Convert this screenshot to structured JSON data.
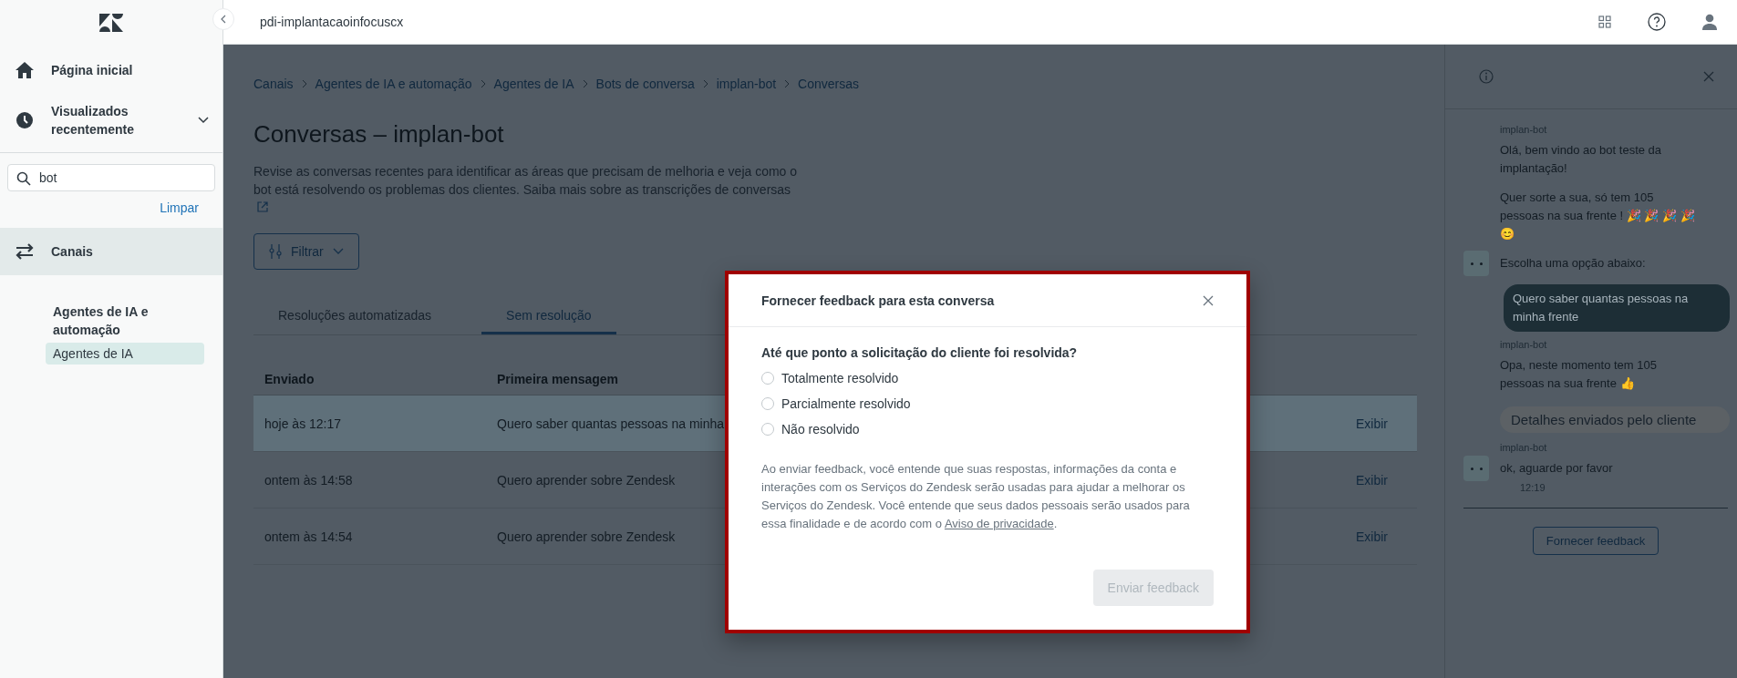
{
  "header": {
    "title": "pdi-implantacaoinfocuscx"
  },
  "sidebar": {
    "nav_items": [
      {
        "label": "Página inicial",
        "kind": "home"
      },
      {
        "label": "Visualizados recentemente",
        "kind": "recent"
      }
    ],
    "search": {
      "value": "bot"
    },
    "clear_link": "Limpar",
    "section": {
      "label": "Canais",
      "selected": true
    },
    "subsection": "Agentes de IA e automação",
    "sub_items": [
      {
        "label": "Agentes de IA",
        "selected": true
      }
    ]
  },
  "page": {
    "breadcrumb": [
      "Canais",
      "Agentes de IA e automação",
      "Agentes de IA",
      "Bots de conversa",
      "implan-bot",
      "Conversas"
    ],
    "title": "Conversas – implan-bot",
    "description": "Revise as conversas recentes para identificar as áreas que precisam de melhoria e veja como o bot está resolvendo os problemas dos clientes. Saiba mais sobre as transcrições de conversas",
    "filter_button": "Filtrar",
    "tabs": [
      {
        "label": "Resoluções automatizadas",
        "selected": false
      },
      {
        "label": "Sem resolução",
        "selected": true
      }
    ],
    "table": {
      "columns": [
        "Enviado",
        "Primeira mensagem"
      ],
      "rows": [
        {
          "sent": "hoje às 12:17",
          "first_message": "Quero saber quantas pessoas na minha",
          "action": "Exibir",
          "selected": true
        },
        {
          "sent": "ontem às 14:58",
          "first_message": "Quero aprender sobre Zendesk",
          "action": "Exibir",
          "selected": false
        },
        {
          "sent": "ontem às 14:54",
          "first_message": "Quero aprender sobre Zendesk",
          "action": "Exibir",
          "selected": false
        }
      ]
    }
  },
  "chat_panel": {
    "messages": [
      {
        "kind": "bot",
        "sender": "implan-bot",
        "avatar": true,
        "bubbles": [
          "Olá, bem vindo ao bot teste da implantação!",
          "Quer sorte a sua, só tem 105 pessoas na sua frente !  🎉 🎉 🎉 🎉 😊",
          "Escolha uma opção abaixo:"
        ]
      },
      {
        "kind": "user",
        "text": "Quero saber quantas pessoas na minha frente"
      },
      {
        "kind": "bot",
        "sender": "implan-bot",
        "avatar": false,
        "bubbles": [
          "Opa, neste momento tem 105 pessoas na sua frente 👍"
        ]
      },
      {
        "kind": "system",
        "text": "Detalhes enviados pelo cliente"
      },
      {
        "kind": "bot",
        "sender": "implan-bot",
        "avatar": true,
        "bubbles": [
          "ok, aguarde por favor"
        ],
        "time": "12:19"
      }
    ],
    "feedback_button": "Fornecer feedback"
  },
  "modal": {
    "title": "Fornecer feedback para esta conversa",
    "question": "Até que ponto a solicitação do cliente foi resolvida?",
    "options": [
      {
        "label": "Totalmente resolvido",
        "selected": false
      },
      {
        "label": "Parcialmente resolvido",
        "selected": false
      },
      {
        "label": "Não resolvido",
        "selected": false
      }
    ],
    "consent": {
      "text": "Ao enviar feedback, você entende que suas respostas, informações da conta e interações com os Serviços do Zendesk serão usadas para ajudar a melhorar os Serviços do Zendesk. Você entende que seus dados pessoais serão usados para essa finalidade e de acordo com o",
      "link": "Aviso de privacidade",
      "after": "."
    },
    "submit": {
      "label": "Enviar feedback",
      "disabled": true
    }
  }
}
